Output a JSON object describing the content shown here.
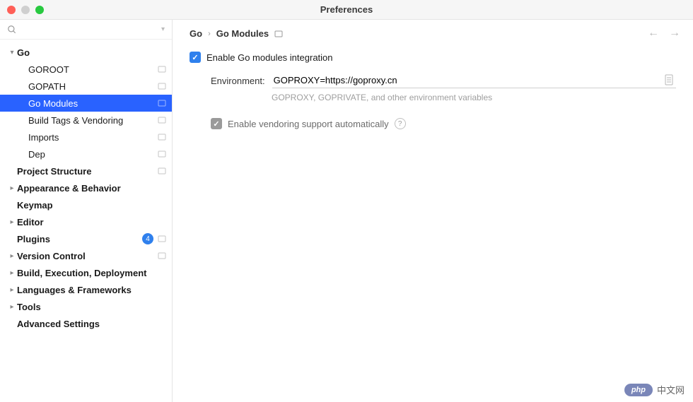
{
  "window": {
    "title": "Preferences"
  },
  "search": {
    "placeholder": ""
  },
  "tree": [
    {
      "label": "Go",
      "indent": 0,
      "bold": true,
      "arrow": "down",
      "projectIcon": false
    },
    {
      "label": "GOROOT",
      "indent": 1,
      "bold": false,
      "arrow": "",
      "projectIcon": true
    },
    {
      "label": "GOPATH",
      "indent": 1,
      "bold": false,
      "arrow": "",
      "projectIcon": true
    },
    {
      "label": "Go Modules",
      "indent": 1,
      "bold": false,
      "arrow": "",
      "projectIcon": true,
      "selected": true
    },
    {
      "label": "Build Tags & Vendoring",
      "indent": 1,
      "bold": false,
      "arrow": "",
      "projectIcon": true
    },
    {
      "label": "Imports",
      "indent": 1,
      "bold": false,
      "arrow": "",
      "projectIcon": true
    },
    {
      "label": "Dep",
      "indent": 1,
      "bold": false,
      "arrow": "",
      "projectIcon": true
    },
    {
      "label": "Project Structure",
      "indent": 0,
      "bold": true,
      "arrow": "",
      "projectIcon": true
    },
    {
      "label": "Appearance & Behavior",
      "indent": 0,
      "bold": true,
      "arrow": "right",
      "projectIcon": false
    },
    {
      "label": "Keymap",
      "indent": 0,
      "bold": true,
      "arrow": "",
      "projectIcon": false
    },
    {
      "label": "Editor",
      "indent": 0,
      "bold": true,
      "arrow": "right",
      "projectIcon": false
    },
    {
      "label": "Plugins",
      "indent": 0,
      "bold": true,
      "arrow": "",
      "projectIcon": true,
      "badge": "4"
    },
    {
      "label": "Version Control",
      "indent": 0,
      "bold": true,
      "arrow": "right",
      "projectIcon": true
    },
    {
      "label": "Build, Execution, Deployment",
      "indent": 0,
      "bold": true,
      "arrow": "right",
      "projectIcon": false
    },
    {
      "label": "Languages & Frameworks",
      "indent": 0,
      "bold": true,
      "arrow": "right",
      "projectIcon": false
    },
    {
      "label": "Tools",
      "indent": 0,
      "bold": true,
      "arrow": "right",
      "projectIcon": false
    },
    {
      "label": "Advanced Settings",
      "indent": 0,
      "bold": true,
      "arrow": "",
      "projectIcon": false
    }
  ],
  "breadcrumb": {
    "root": "Go",
    "current": "Go Modules"
  },
  "form": {
    "enable_label": "Enable Go modules integration",
    "env_label": "Environment:",
    "env_value": "GOPROXY=https://goproxy.cn",
    "env_hint": "GOPROXY, GOPRIVATE, and other environment variables",
    "vendoring_label": "Enable vendoring support automatically"
  },
  "watermark": {
    "badge": "php",
    "text": "中文网"
  }
}
